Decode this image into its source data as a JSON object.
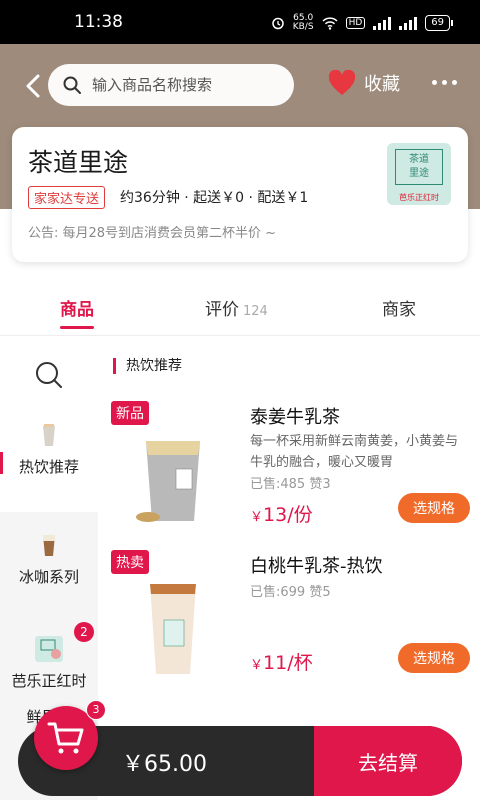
{
  "status_bar": {
    "time": "11:38",
    "speed_value": "65.0",
    "speed_unit": "KB/S",
    "hd": "HD",
    "net1": "4G",
    "net2": "4G",
    "battery": "69"
  },
  "header": {
    "search_placeholder": "输入商品名称搜索",
    "favorite_label": "收藏"
  },
  "shop": {
    "name": "茶道里途",
    "delivery_badge": "家家达专送",
    "delivery_info": "约36分钟 · 起送￥0 · 配送￥1",
    "notice": "公告: 每月28号到店消费会员第二杯半价 ~",
    "logo_text_line1": "茶道",
    "logo_text_line2": "里途",
    "logo_caption": "芭乐正红时"
  },
  "tabs": [
    {
      "label": "商品"
    },
    {
      "label": "评价",
      "count": "124"
    },
    {
      "label": "商家"
    }
  ],
  "sidebar": {
    "items": [
      {
        "label": "热饮推荐"
      },
      {
        "label": "冰咖系列"
      },
      {
        "label": "芭乐正红时",
        "badge": "2"
      },
      {
        "label": "鲜果饮"
      }
    ]
  },
  "section_title": "热饮推荐",
  "products": [
    {
      "tag": "新品",
      "name": "泰姜牛乳茶",
      "desc": "每一杯采用新鲜云南黄姜，小黄姜与牛乳的融合，暖心又暖胃",
      "sales": "已售:485 赞3",
      "price_symbol": "￥",
      "price": "13/份",
      "button": "选规格"
    },
    {
      "tag": "热卖",
      "name": "白桃牛乳茶-热饮",
      "sales": "已售:699 赞5",
      "price_symbol": "￥",
      "price": "11/杯",
      "button": "选规格"
    }
  ],
  "cart": {
    "total": "￥65.00",
    "checkout_label": "去结算",
    "badge": "3"
  },
  "colors": {
    "accent": "#e0174b",
    "button_orange": "#f06b2a",
    "header_bg": "#9e8b7b",
    "cart_bar": "#2a2a2a"
  }
}
